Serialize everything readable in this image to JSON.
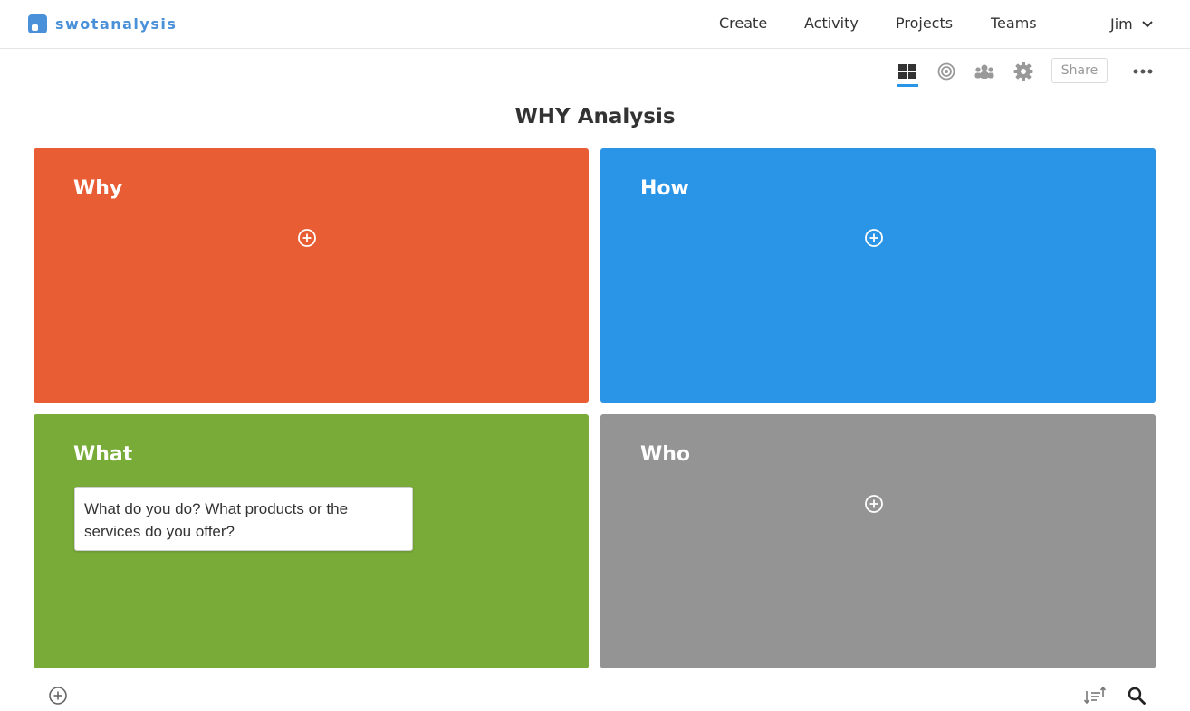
{
  "brand": {
    "name": "swotanalysis",
    "color": "#4a90d9"
  },
  "nav": {
    "create": "Create",
    "activity": "Activity",
    "projects": "Projects",
    "teams": "Teams",
    "user": "Jim"
  },
  "toolbar": {
    "share_label": "Share",
    "icons": [
      "grid-view-icon",
      "target-icon",
      "team-icon",
      "gear-icon",
      "more-icon"
    ],
    "active_view": "grid-view-icon",
    "accent": "#2a94e6"
  },
  "page": {
    "title": "WHY Analysis"
  },
  "quadrants": [
    {
      "title": "Why",
      "color": "#e95d35"
    },
    {
      "title": "How",
      "color": "#2a94e6"
    },
    {
      "title": "What",
      "color": "#78ab38",
      "note": "What do you do? What products or the services do you offer?"
    },
    {
      "title": "Who",
      "color": "#949494"
    }
  ]
}
